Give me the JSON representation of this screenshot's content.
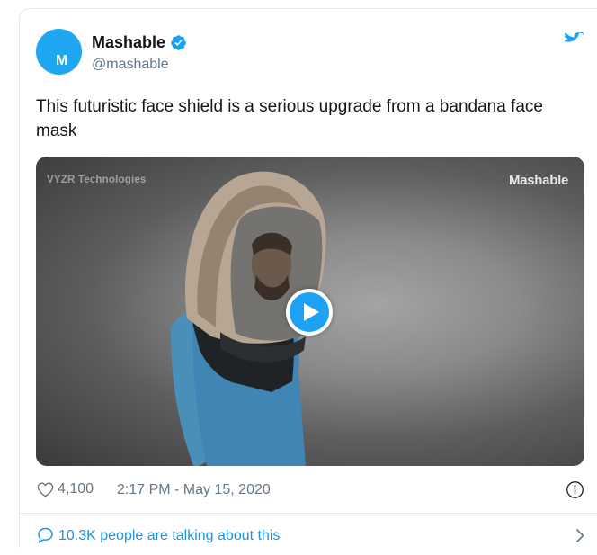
{
  "tweet": {
    "author_name": "Mashable",
    "author_handle": "@mashable",
    "avatar_letter": "M",
    "text": "This futuristic face shield is a serious upgrade from a bandana face mask",
    "video": {
      "watermark_left": "VYZR Technologies",
      "watermark_right": "Mashable"
    },
    "likes": "4,100",
    "timestamp": "2:17 PM - May 15, 2020",
    "talking": "10.3K people are talking about this"
  },
  "icons": {
    "verified": "verified-badge-icon",
    "logo": "twitter-bird-icon",
    "play": "play-icon",
    "like": "heart-icon",
    "info": "info-icon",
    "conversation": "speech-bubble-icon",
    "chevron": "chevron-right-icon"
  },
  "colors": {
    "brand_blue": "#1da1f2",
    "link_blue": "#1b95e0",
    "secondary_text": "#657786",
    "border": "#e1e8ed"
  }
}
